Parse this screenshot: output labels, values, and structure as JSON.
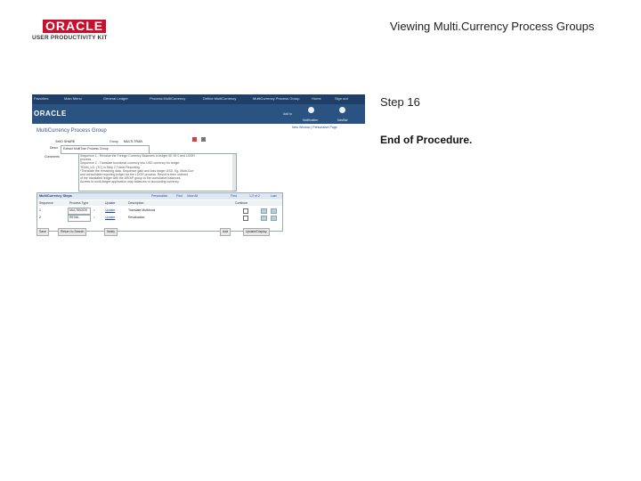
{
  "header": {
    "logo_text": "ORACLE",
    "logo_subtext": "USER PRODUCTIVITY KIT",
    "doc_title": "Viewing Multi.Currency Process Groups"
  },
  "step": {
    "label": "Step 16",
    "status": "End of Procedure."
  },
  "screenshot": {
    "topnav": [
      "Favorites",
      "Main Menu",
      "General Ledger",
      "Process MultiCurrency",
      "Define MultiCurrency",
      "MultiCurrency Process Group"
    ],
    "brand": "ORACLE",
    "bar_links": [
      "Home",
      "Sign out",
      "Add to",
      "Notification",
      "NavBar"
    ],
    "sub_links": "New Window | Personalize Page",
    "page_title": "MultiCurrency Process Group",
    "setid_label": "SetID",
    "setid_value": "SHARE",
    "group_label": "Group",
    "group_value": "MULTI-TRAN",
    "descr_label": "Descr",
    "descr_value": "Extract MultiTran Process Group",
    "comments_label": "Comments",
    "comments_lines": [
      "Sequence 1 - Revalue the Foreign Currency Balances in ledger 0E 99 0 and LDGR",
      "process.",
      "Sequence 2 - Translate functional currency into USD currency for ledger",
      "TRAN_LG. (TC) in Step 2 Transl Reporting.",
      "*Translate the remaining data. Sequence gain and loss ledger USD. Eg. Multi-Curr",
      "and consolidate reporting ledger for the LDGR process. Result is then ordered",
      "of the translated ledger with the AR/AP group to the cumulative balances.",
      "Access to multi-ledger application may balances of accounting currency."
    ],
    "grid_title": "MultiCurrency Steps",
    "grid_right": [
      "Personalize",
      "Find",
      "View All",
      "First",
      "1-2 of 2",
      "Last"
    ],
    "columns": [
      "Sequence",
      "Process Type",
      "Update",
      "Description",
      "Continue"
    ],
    "rows": [
      {
        "seq": "1",
        "process": "MULTIBOOK",
        "update": "Update",
        "description": "Translate Multibook"
      },
      {
        "seq": "2",
        "process": "REVAL",
        "update": "Update",
        "description": "Revaluation"
      }
    ],
    "buttons": [
      "Save",
      "Return to Search",
      "Notify",
      "Add",
      "Update/Display"
    ]
  }
}
